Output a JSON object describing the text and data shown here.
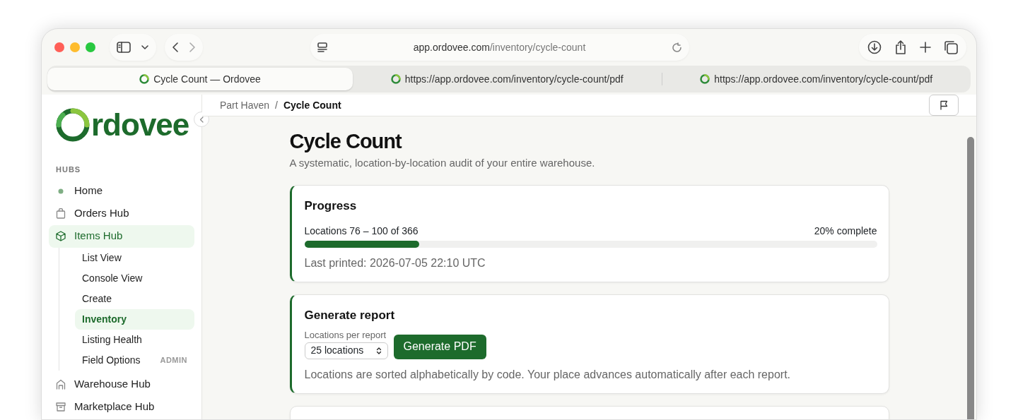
{
  "browser": {
    "address_host": "app.ordovee.com",
    "address_path": "/inventory/cycle-count",
    "tabs": [
      {
        "label": "Cycle Count — Ordovee",
        "selected": true
      },
      {
        "label": "https://app.ordovee.com/inventory/cycle-count/pdf",
        "selected": false
      },
      {
        "label": "https://app.ordovee.com/inventory/cycle-count/pdf",
        "selected": false
      }
    ]
  },
  "sidebar": {
    "logo_text": "rdovee",
    "section_label": "HUBS",
    "items": [
      {
        "label": "Home",
        "selected": false
      },
      {
        "label": "Orders Hub",
        "selected": false
      },
      {
        "label": "Items Hub",
        "selected": true,
        "children": [
          {
            "label": "List View",
            "selected": false
          },
          {
            "label": "Console View",
            "selected": false
          },
          {
            "label": "Create",
            "selected": false
          },
          {
            "label": "Inventory",
            "selected": true
          },
          {
            "label": "Listing Health",
            "selected": false
          },
          {
            "label": "Field Options",
            "selected": false,
            "badge": "ADMIN"
          }
        ]
      },
      {
        "label": "Warehouse Hub",
        "selected": false
      },
      {
        "label": "Marketplace Hub",
        "selected": false
      }
    ]
  },
  "breadcrumb": [
    "Part Haven",
    "Cycle Count"
  ],
  "breadcrumb_separator": "/",
  "page": {
    "title": "Cycle Count",
    "subtitle": "A systematic, location-by-location audit of your entire warehouse.",
    "progress": {
      "title": "Progress",
      "range": "Locations 76 – 100 of 366",
      "percent": "20% complete",
      "level": 0.2,
      "last_printed": "Last printed: 2026-07-05 22:10 UTC"
    },
    "report": {
      "title": "Generate report",
      "select_label": "Locations per report",
      "select_value": "25 locations",
      "button": "Generate PDF",
      "note": "Locations are sorted alphabetically by code. Your place advances automatically after each report."
    }
  }
}
